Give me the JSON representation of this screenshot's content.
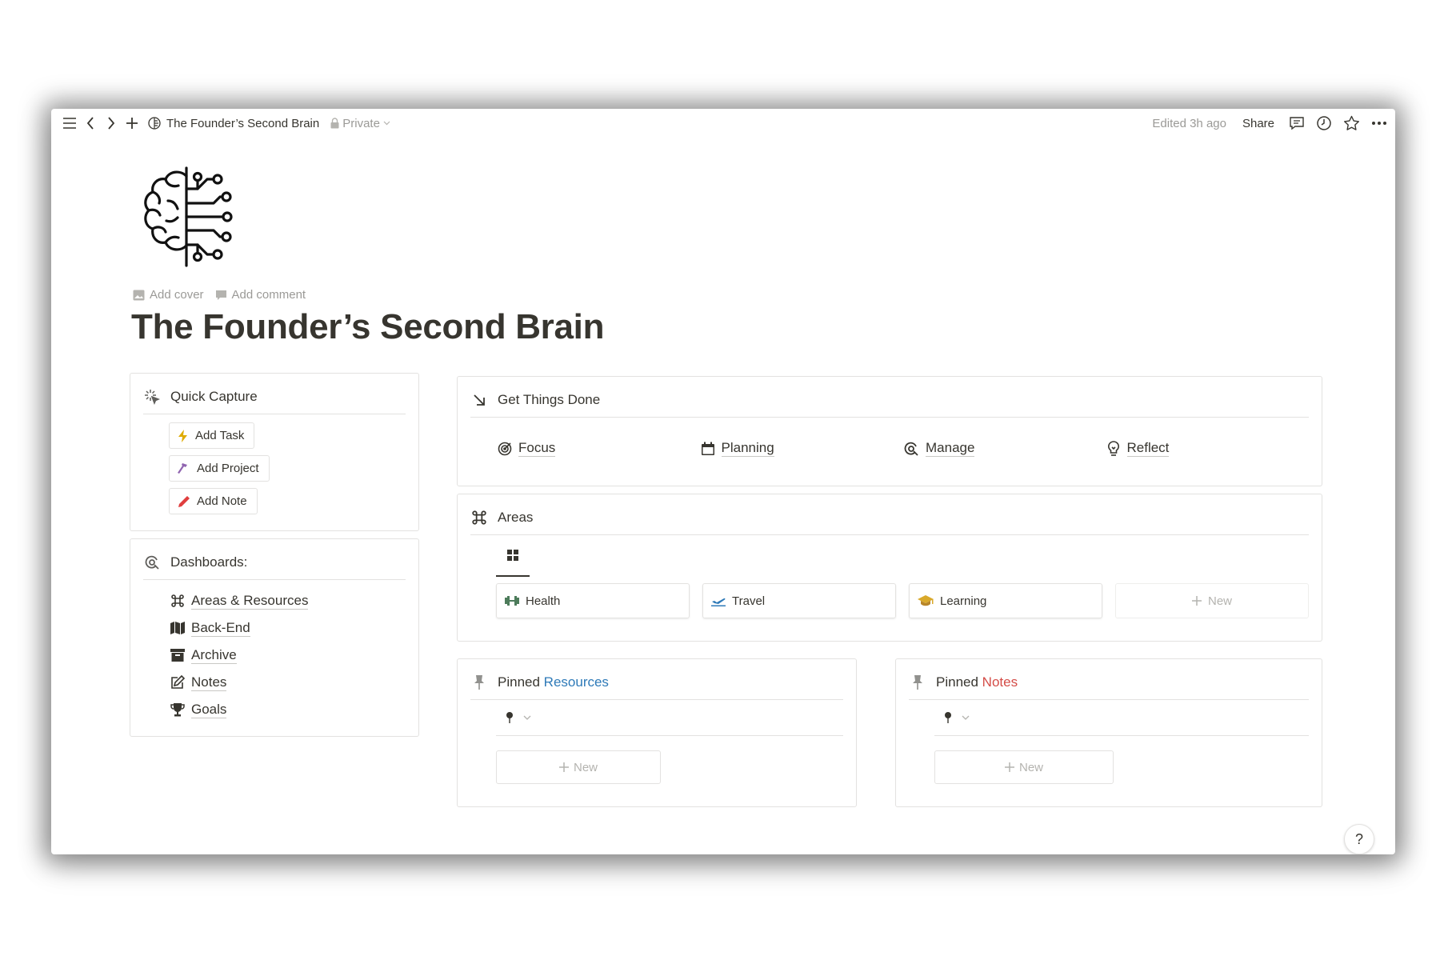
{
  "topbar": {
    "page_title": "The Founder’s Second Brain",
    "privacy": "Private",
    "edited": "Edited 3h ago",
    "share_label": "Share"
  },
  "page": {
    "add_cover": "Add cover",
    "add_comment": "Add comment",
    "title": "The Founder’s Second Brain"
  },
  "quick_capture": {
    "title": "Quick Capture",
    "buttons": [
      {
        "label": "Add Task",
        "icon": "lightning-icon",
        "color": "#dfab01"
      },
      {
        "label": "Add Project",
        "icon": "hammer-icon",
        "color": "#9065b0"
      },
      {
        "label": "Add Note",
        "icon": "pencil-icon",
        "color": "#e03e3e"
      }
    ]
  },
  "dashboards": {
    "title": "Dashboards:",
    "items": [
      {
        "label": "Areas & Resources",
        "icon": "command-icon"
      },
      {
        "label": "Back-End",
        "icon": "map-icon"
      },
      {
        "label": "Archive",
        "icon": "archive-icon"
      },
      {
        "label": "Notes",
        "icon": "edit-icon"
      },
      {
        "label": "Goals",
        "icon": "trophy-icon"
      }
    ]
  },
  "get_things_done": {
    "title": "Get Things Done",
    "items": [
      {
        "label": "Focus",
        "icon": "target-icon"
      },
      {
        "label": "Planning",
        "icon": "calendar-icon"
      },
      {
        "label": "Manage",
        "icon": "cycle-icon"
      },
      {
        "label": "Reflect",
        "icon": "lightbulb-icon"
      }
    ]
  },
  "areas": {
    "title": "Areas",
    "cards": [
      {
        "label": "Health",
        "icon": "dumbbell-icon",
        "color": "#4d7c5b"
      },
      {
        "label": "Travel",
        "icon": "plane-icon",
        "color": "#2e7ab8"
      },
      {
        "label": "Learning",
        "icon": "graduation-cap-icon",
        "color": "#d9a92b"
      }
    ],
    "new_label": "New"
  },
  "pinned_resources": {
    "title_prefix": "Pinned",
    "title_accent": "Resources",
    "accent_color": "#2e7ab8",
    "new_label": "New"
  },
  "pinned_notes": {
    "title_prefix": "Pinned",
    "title_accent": "Notes",
    "accent_color": "#d44c47",
    "new_label": "New"
  },
  "help": {
    "label": "?"
  }
}
